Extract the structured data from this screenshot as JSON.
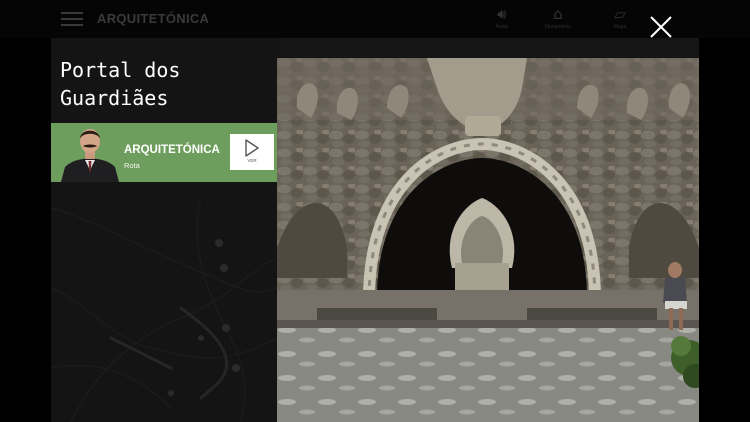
{
  "header": {
    "app_title": "ARQUITETÓNICA",
    "tools": [
      {
        "icon": "audio-icon",
        "label": "Áudio"
      },
      {
        "icon": "monument-icon",
        "label": "Monumento"
      },
      {
        "icon": "map-icon",
        "label": "Mapa"
      }
    ]
  },
  "poi": {
    "title_line1": "Portal dos",
    "title_line2": "Guardiães"
  },
  "route_card": {
    "name": "ARQUITETÓNICA",
    "type": "Rota",
    "button_label": "VER"
  },
  "colors": {
    "accent_green": "#6e9e5d",
    "background": "#000000",
    "panel": "#151515"
  }
}
